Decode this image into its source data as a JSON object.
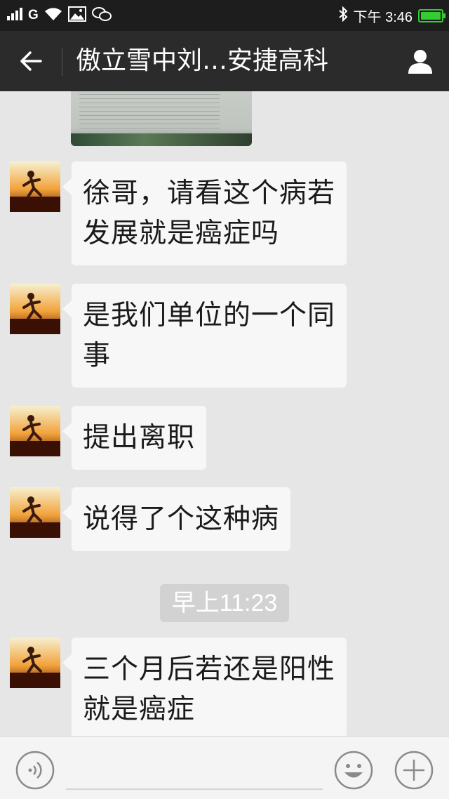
{
  "status_bar": {
    "carrier": "G",
    "clock": "下午 3:46",
    "battery_level": 1.0,
    "icons": [
      "signal-icon",
      "wifi-icon",
      "gallery-icon",
      "wechat-icon",
      "bluetooth-icon",
      "battery-icon"
    ]
  },
  "header": {
    "title": "傲立雪中刘…安捷高科",
    "back_icon": "arrow-left-icon",
    "profile_icon": "person-icon"
  },
  "messages": [
    {
      "text_lines": [
        "徐哥，请看这个病若",
        "发展就是癌症吗"
      ]
    },
    {
      "text_lines": [
        "是我们单位的一个同",
        "事"
      ]
    },
    {
      "text_lines": [
        "提出离职"
      ]
    },
    {
      "text_lines": [
        "说得了个这种病"
      ]
    },
    {
      "text_lines": [
        "三个月后若还是阳性",
        "就是癌症"
      ]
    }
  ],
  "timestamp": "早上11:23",
  "input_bar": {
    "voice_icon": "voice-icon",
    "emoji_icon": "smiley-icon",
    "plus_icon": "plus-icon"
  },
  "colors": {
    "status_bar_bg": "#1d1d1d",
    "header_bg": "#2b2b2b",
    "chat_bg": "#e6e6e6",
    "bubble_bg": "#f7f7f7",
    "battery": "#33cc33"
  }
}
